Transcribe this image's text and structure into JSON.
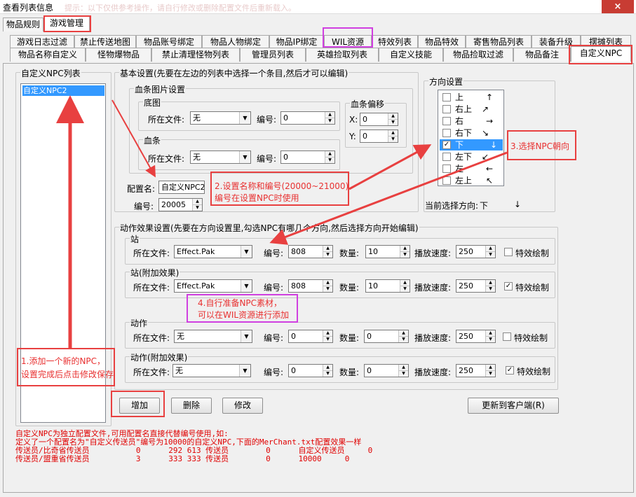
{
  "window": {
    "title": "查看列表信息",
    "faded_title": "提示：以下仅供参考操作，请自行修改或删除配置文件后重新载入。",
    "close_icon": "×"
  },
  "top_tabs": [
    "物品规则",
    "游戏管理"
  ],
  "tabs_row1": [
    "游戏日志过滤",
    "禁止传送地图",
    "物品账号绑定",
    "物品人物绑定",
    "物品IP绑定",
    "WIL资源",
    "特效列表",
    "物品特效",
    "寄售物品列表",
    "装备升级",
    "摆摊列表"
  ],
  "tabs_row2": [
    "物品名称自定义",
    "怪物爆物品",
    "禁止清理怪物列表",
    "管理员列表",
    "英雄捡取列表",
    "自定义技能",
    "物品捡取过滤",
    "物品备注",
    "自定义NPC"
  ],
  "npc_list": {
    "title": "自定义NPC列表",
    "items": [
      "自定义NPC2"
    ]
  },
  "basic": {
    "title": "基本设置(先要在左边的列表中选择一个条目,然后才可以编辑)",
    "blood_img_title": "血条图片设置",
    "base_title": "底图",
    "bar_title": "血条",
    "file_label": "所在文件:",
    "num_label": "编号:",
    "base_file": "无",
    "base_num": "0",
    "bar_file": "无",
    "bar_num": "0",
    "offset_title": "血条偏移",
    "x_label": "X:",
    "x_value": "0",
    "y_label": "Y:",
    "y_value": "0",
    "config_name_label": "配置名:",
    "config_name_value": "自定义NPC2",
    "id_label": "编号:",
    "id_value": "20005"
  },
  "direction": {
    "title": "方向设置",
    "items": [
      {
        "label": "上",
        "arrow": "↑",
        "checked": false
      },
      {
        "label": "右上",
        "arrow": "↗",
        "checked": false
      },
      {
        "label": "右",
        "arrow": "→",
        "checked": false
      },
      {
        "label": "右下",
        "arrow": "↘",
        "checked": false
      },
      {
        "label": "下",
        "arrow": "↓",
        "checked": true
      },
      {
        "label": "左下",
        "arrow": "↙",
        "checked": false
      },
      {
        "label": "左",
        "arrow": "←",
        "checked": false
      },
      {
        "label": "左上",
        "arrow": "↖",
        "checked": false
      }
    ],
    "current_label": "当前选择方向:",
    "current_value": "下",
    "current_arrow": "↓"
  },
  "action": {
    "title": "动作效果设置(先要在方向设置里,勾选NPC有哪几个方向,然后选择方向开始编辑)",
    "file_label": "所在文件:",
    "num_label": "编号:",
    "count_label": "数量:",
    "speed_label": "播放速度:",
    "effect_label": "特效绘制",
    "rows": [
      {
        "title": "站",
        "file": "Effect.Pak",
        "num": "808",
        "count": "10",
        "speed": "250",
        "effect": false
      },
      {
        "title": "站(附加效果)",
        "file": "Effect.Pak",
        "num": "808",
        "count": "10",
        "speed": "250",
        "effect": true
      },
      {
        "title": "动作",
        "file": "无",
        "num": "0",
        "count": "0",
        "speed": "250",
        "effect": false
      },
      {
        "title": "动作(附加效果)",
        "file": "无",
        "num": "0",
        "count": "0",
        "speed": "250",
        "effect": true
      }
    ]
  },
  "buttons": {
    "add": "增加",
    "delete": "删除",
    "modify": "修改",
    "update": "更新到客户端(R)"
  },
  "notes": [
    "自定义NPC为独立配置文件,可用配置名直接代替编号使用,如:",
    "定义了一个配置名为\"自定义传送员\"编号为10000的自定义NPC,下面的MerChant.txt配置效果一样",
    "传送员/比奇省传送员          0      292 613 传送员        0      自定义传送员     0",
    "传送员/盟重省传送员          3      333 333 传送员        0      10000     0"
  ],
  "annotations": {
    "step1": [
      "1.添加一个新的NPC，",
      "设置完成后点击修改保存"
    ],
    "step2": [
      "2.设置名称和编号(20000~21000)",
      "编号在设置NPC时使用"
    ],
    "step3": "3.选择NPC朝向",
    "step4": [
      "4.自行准备NPC素材，",
      "可以在WIL资源进行添加"
    ]
  },
  "colors": {
    "annotation_red": "#e84040",
    "annotation_pink": "#d040e0",
    "selection_blue": "#3399ff",
    "note_red": "#e00000"
  }
}
